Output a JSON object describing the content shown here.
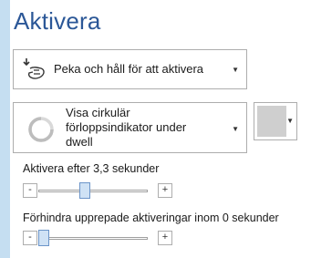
{
  "panel": {
    "title": "Aktivera"
  },
  "activation_mode": {
    "selected": "Peka och håll för att aktivera",
    "icon": "touch-hold-icon"
  },
  "progress_mode": {
    "selected": "Visa cirkulär förloppsindikator under dwell",
    "icon": "circular-progress-icon"
  },
  "color_picker": {
    "color": "#cfcfcf"
  },
  "activate_after": {
    "label": "Aktivera efter 3,3 sekunder",
    "minus": "-",
    "plus": "+",
    "level": 0.42
  },
  "prevent_repeat": {
    "label": "Förhindra upprepade aktiveringar inom 0 sekunder",
    "minus": "-",
    "plus": "+",
    "level": 0.0
  },
  "dropdown_arrow": "▼"
}
